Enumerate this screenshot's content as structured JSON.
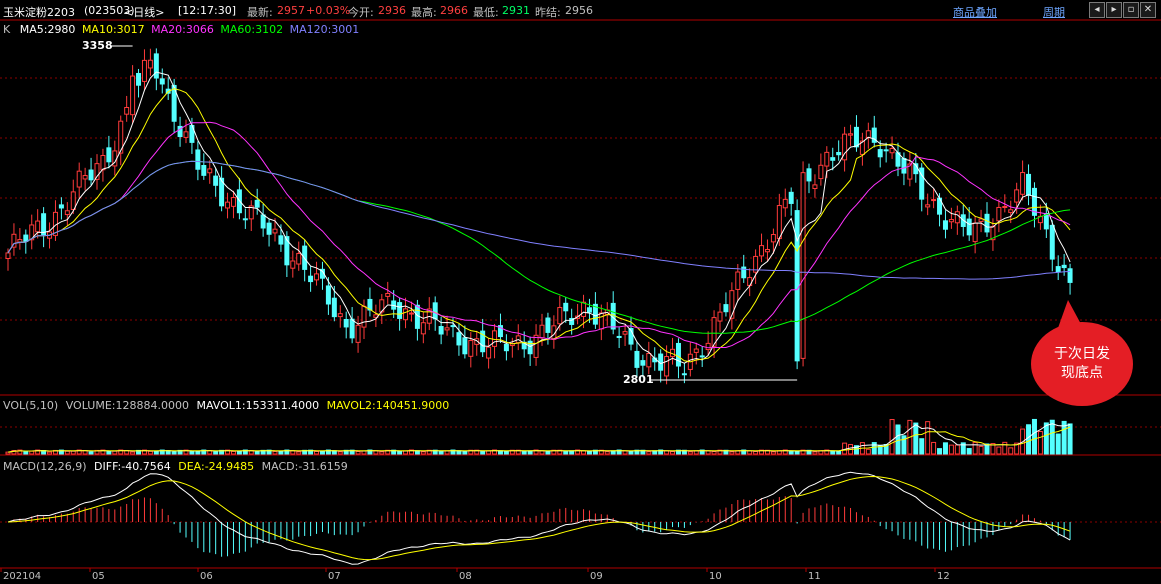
{
  "header": {
    "symbol": "玉米淀粉2203",
    "code": "(023503)",
    "period": "<日线>",
    "time": "[12:17:30]",
    "latest_label": "最新:",
    "latest": "2957",
    "change": "+0.03%",
    "open_label": "今开:",
    "open": "2936",
    "high_label": "最高:",
    "high": "2966",
    "low_label": "最低:",
    "low": "2931",
    "prev_label": "昨结:",
    "prev": "2956",
    "overlay_link": "商品叠加",
    "cycle_link": "周期"
  },
  "main_legend": {
    "k": "K",
    "ma5": "MA5:2980",
    "ma10": "MA10:3017",
    "ma20": "MA20:3066",
    "ma60": "MA60:3102",
    "ma120": "MA120:3001"
  },
  "vol_legend": {
    "title": "VOL(5,10)",
    "volume": "VOLUME:128884.0000",
    "mavol1": "MAVOL1:153311.4000",
    "mavol2": "MAVOL2:140451.9000"
  },
  "macd_legend": {
    "title": "MACD(12,26,9)",
    "diff": "DIFF:-40.7564",
    "dea": "DEA:-24.9485",
    "macd": "MACD:-31.6159"
  },
  "annotations": {
    "high_label": "3358",
    "low_label": "2801",
    "callout": "于次日发\n现底点"
  },
  "x_axis": [
    "202104",
    "05",
    "06",
    "07",
    "08",
    "09",
    "10",
    "11",
    "12"
  ],
  "colors": {
    "up": "#ff3b3b",
    "down": "#54ffff",
    "ma5": "#ffffff",
    "ma10": "#ffff00",
    "ma20": "#ff33ff",
    "ma60": "#00ff00",
    "ma120": "#8080ff",
    "grid": "#8b0000",
    "label": "#ffffff",
    "red_text": "#ff4040"
  },
  "chart_data": {
    "type": "candlestick",
    "price_waypoints": [
      {
        "month": "202104",
        "close": 3010
      },
      {
        "month": "04-mid",
        "close": 3080
      },
      {
        "month": "05-early",
        "close": 3180
      },
      {
        "month": "05-peak",
        "close": 3358
      },
      {
        "month": "05-late",
        "close": 3150
      },
      {
        "month": "06",
        "close": 3080
      },
      {
        "month": "06-late",
        "close": 3000
      },
      {
        "month": "07",
        "close": 2880
      },
      {
        "month": "07-mid",
        "close": 2920
      },
      {
        "month": "07-late",
        "close": 2870
      },
      {
        "month": "08",
        "close": 2840
      },
      {
        "month": "08-mid",
        "close": 2860
      },
      {
        "month": "08-late",
        "close": 2920
      },
      {
        "month": "09",
        "close": 2830
      },
      {
        "month": "09-low",
        "close": 2801
      },
      {
        "month": "10",
        "close": 2930
      },
      {
        "month": "10-late",
        "close": 3080
      },
      {
        "month": "11",
        "close": 3190
      },
      {
        "month": "11-peak",
        "close": 3220
      },
      {
        "month": "11-late",
        "close": 3110
      },
      {
        "month": "12",
        "close": 3040
      },
      {
        "month": "12-mid",
        "close": 3130
      },
      {
        "month": "12-late",
        "close": 2957
      }
    ],
    "ma_last": {
      "MA5": 2980,
      "MA10": 3017,
      "MA20": 3066,
      "MA60": 3102,
      "MA120": 3001
    },
    "volume_last": 128884,
    "mavol1_last": 153311.4,
    "mavol2_last": 140451.9,
    "macd_last": {
      "DIFF": -40.7564,
      "DEA": -24.9485,
      "MACD": -31.6159
    },
    "high": 3358,
    "low": 2801
  }
}
